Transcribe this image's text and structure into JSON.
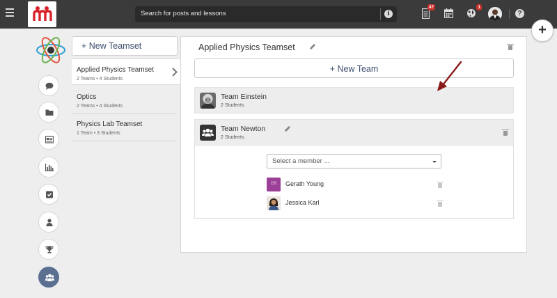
{
  "topbar": {
    "search_placeholder": "Search for posts and lessons",
    "notifications_count": "47",
    "globe_count": "1"
  },
  "teamsets": {
    "new_button_label": "+ New Teamset",
    "items": [
      {
        "name": "Applied Physics Teamset",
        "meta": "2 Teams • 4 Students",
        "selected": true
      },
      {
        "name": "Optics",
        "meta": "2 Teams • 4 Students",
        "selected": false
      },
      {
        "name": "Physics Lab Teamset",
        "meta": "1 Team • 3 Students",
        "selected": false
      }
    ]
  },
  "main": {
    "title": "Applied Physics Teamset",
    "new_team_label": "+ New Team",
    "teams": [
      {
        "name": "Team Einstein",
        "meta": "2 Students"
      },
      {
        "name": "Team Newton",
        "meta": "2 Students"
      }
    ],
    "member_select_placeholder": "Select a member ...",
    "members": [
      {
        "name": "Gerath Young",
        "initials": "GB",
        "avatar_color": "#9b3f97"
      },
      {
        "name": "Jessica Karl"
      }
    ]
  },
  "colors": {
    "topbar": "#3b3b3b",
    "accent_blue": "#3c4f6e",
    "active_rail": "#5b6f91",
    "badge": "#c9302c",
    "annotation_arrow": "#8b1a1a"
  }
}
